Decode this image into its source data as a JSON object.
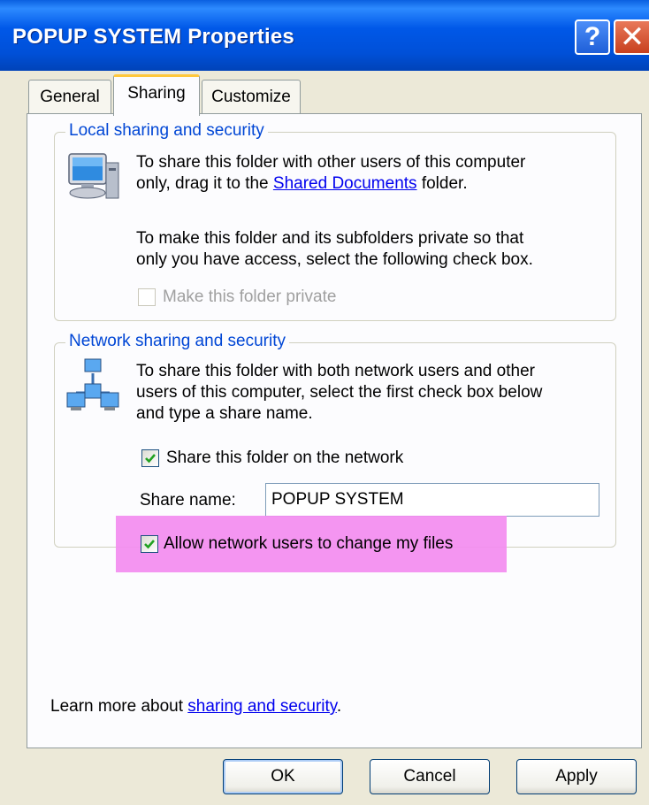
{
  "window": {
    "title": "POPUP SYSTEM Properties",
    "help_glyph": "?",
    "close_glyph": "✕"
  },
  "tabs": [
    {
      "label": "General"
    },
    {
      "label": "Sharing",
      "active": true
    },
    {
      "label": "Customize"
    }
  ],
  "local": {
    "title": "Local sharing and security",
    "text1_line1": "To share this folder with other users of this computer",
    "text1_prefix": "only, drag it to the ",
    "text1_link": "Shared Documents",
    "text1_suffix": " folder.",
    "text2_line1": "To make this folder and its subfolders private so that",
    "text2_line2": "only you have access, select the following check box.",
    "private_label": "Make this folder private",
    "private_checked": false,
    "private_disabled": true
  },
  "network": {
    "title": "Network sharing and security",
    "text_line1": "To share this folder with both network users and other",
    "text_line2": "users of this computer, select the first check box below",
    "text_line3": "and type a share name.",
    "share_label": "Share this folder on the network",
    "share_checked": true,
    "share_name_label": "Share name:",
    "share_name_value": "POPUP SYSTEM",
    "allow_label": "Allow network users to change my files",
    "allow_checked": true
  },
  "learn": {
    "prefix": "Learn more about ",
    "link": "sharing and security",
    "suffix": "."
  },
  "buttons": {
    "ok": "OK",
    "cancel": "Cancel",
    "apply": "Apply"
  },
  "colors": {
    "title_bar": "#0058e8",
    "group_title": "#0046d5",
    "highlight": "#f38cf0",
    "link": "#0000ee"
  }
}
